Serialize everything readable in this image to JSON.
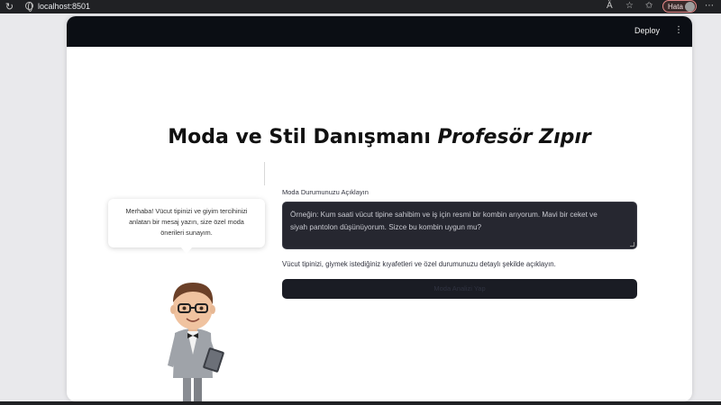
{
  "browser": {
    "url": "localhost:8501",
    "profile_label": "Hata"
  },
  "app": {
    "header": {
      "deploy_label": "Deploy",
      "menu_glyph": "⋮"
    },
    "title_main": "Moda ve Stil Danışmanı ",
    "title_emphasis": "Profesör Zıpır",
    "bubble": {
      "line1": "Merhaba! Vücut tipinizi ve giyim tercihinizi",
      "line2": "anlatan bir mesaj yazın, size özel moda",
      "line3": "önerileri sunayım."
    },
    "form": {
      "label": "Moda Durumunuzu Açıklayın",
      "placeholder_line1": "Örneğin: Kum saati vücut tipine sahibim ve iş için resmi bir kombin arıyorum. Mavi bir ceket ve",
      "placeholder_line2": "siyah pantolon düşünüyorum. Sizce bu kombin uygun mu?",
      "help": "Vücut tipinizi, giymek istediğiniz kıyafetleri ve özel durumunuzu detaylı şekilde açıklayın.",
      "submit_label": "Moda Analizi Yap"
    }
  },
  "colors": {
    "header_bg": "#0b0e14",
    "input_bg": "#262730",
    "button_bg": "#1a1c24"
  },
  "icons": [
    "refresh-icon",
    "globe-icon",
    "reader-mode-icon",
    "star-icon",
    "favorites-icon",
    "kebab-menu-icon"
  ]
}
